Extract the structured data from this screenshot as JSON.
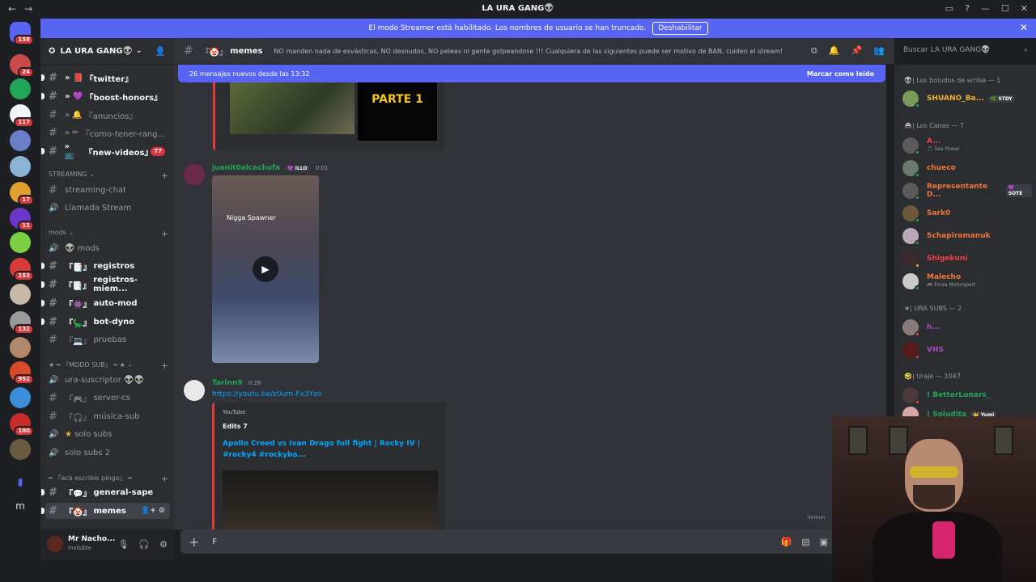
{
  "titlebar": {
    "title": "LA URA GANG👽",
    "back": "←",
    "forward": "→",
    "right_icons": [
      "▭",
      "?",
      "—",
      "☐",
      "✕"
    ]
  },
  "banner": {
    "text": "El modo Streamer está habilitado. Los nombres de usuario se han truncado.",
    "button": "Deshabilitar",
    "close": "✕"
  },
  "guilds": [
    {
      "name": "discord-home-icon",
      "badge": "158",
      "color": "#5865f2"
    },
    {
      "name": "server-icon-1",
      "badge": "24",
      "color": "#c94b4b"
    },
    {
      "name": "server-icon-2",
      "badge": "",
      "color": "#23a559"
    },
    {
      "name": "server-icon-3",
      "badge": "117",
      "color": "#f2f3f5"
    },
    {
      "name": "server-icon-4",
      "badge": "",
      "color": "#6a7ec9"
    },
    {
      "name": "server-icon-5",
      "badge": "",
      "color": "#8ab4d6"
    },
    {
      "name": "server-icon-6",
      "badge": "17",
      "color": "#e0a030"
    },
    {
      "name": "server-icon-7",
      "badge": "11",
      "color": "#6b35c9"
    },
    {
      "name": "server-icon-8",
      "badge": "",
      "color": "#7ccf44"
    },
    {
      "name": "server-icon-9",
      "badge": "153",
      "color": "#d83a3a"
    },
    {
      "name": "server-icon-10",
      "badge": "",
      "color": "#c7b8a8"
    },
    {
      "name": "server-icon-11",
      "badge": "132",
      "color": "#9a9a9a"
    },
    {
      "name": "server-icon-12",
      "badge": "",
      "color": "#b2876a"
    },
    {
      "name": "server-icon-13",
      "badge": "952",
      "color": "#d84a2a"
    },
    {
      "name": "server-icon-14",
      "badge": "",
      "color": "#3b8ed8"
    },
    {
      "name": "server-icon-15",
      "badge": "100",
      "color": "#c92a2a"
    },
    {
      "name": "server-icon-16",
      "badge": "",
      "color": "#6a5a40"
    }
  ],
  "server": {
    "name": "LA URA GANG👽",
    "channels": [
      {
        "label": "『twitter』",
        "prefix": "» 📕",
        "bold": true,
        "badge": ""
      },
      {
        "label": "『boost-honors』",
        "prefix": "» 💜",
        "bold": true,
        "badge": ""
      },
      {
        "label": "『anuncios』",
        "prefix": "» 🔔",
        "bold": false,
        "badge": ""
      },
      {
        "label": "『como-tener-rang...",
        "prefix": "» ✏",
        "bold": false,
        "badge": ""
      },
      {
        "label": "『new-videos』",
        "prefix": "» 📺",
        "bold": true,
        "badge": "77"
      }
    ],
    "cat_streaming": "STREAMING",
    "streaming": [
      {
        "label": "streaming-chat",
        "icon": "#"
      },
      {
        "label": "Llamada Stream",
        "icon": "🔊"
      }
    ],
    "cat_mods": "mods",
    "mods": [
      {
        "label": "mods",
        "icon": "🔊",
        "prefix": "👽",
        "bold": false
      },
      {
        "label": "registros",
        "icon": "#",
        "prefix": "『📑』",
        "bold": true
      },
      {
        "label": "registros-miem...",
        "icon": "#",
        "prefix": "『📑』",
        "bold": true
      },
      {
        "label": "auto-mod",
        "icon": "#",
        "prefix": "『👾』",
        "bold": true
      },
      {
        "label": "bot-dyno",
        "icon": "#",
        "prefix": "『🦕』",
        "bold": true
      },
      {
        "label": "pruebas",
        "icon": "#",
        "prefix": "『💻』",
        "bold": false
      }
    ],
    "cat_modo_sub": "★ ━ 『MODO SUB』 ━ ★",
    "modo_sub": [
      {
        "label": "ura-suscriptor 👽👽",
        "icon": "🔊",
        "prefix": "",
        "bold": false
      },
      {
        "label": "server-cs",
        "icon": "#",
        "prefix": "『🎮』",
        "bold": false
      },
      {
        "label": "música-sub",
        "icon": "#",
        "prefix": "『🎧』",
        "bold": false
      },
      {
        "label": "solo subs",
        "icon": "🔊",
        "prefix": "★",
        "bold": false
      },
      {
        "label": "solo subs 2",
        "icon": "🔊",
        "prefix": "",
        "bold": false
      }
    ],
    "cat_aca": "━ 『acá escribís pingo』 ━",
    "aca": [
      {
        "label": "general-sape",
        "prefix": "『💬』",
        "active": false
      },
      {
        "label": "memes",
        "prefix": "『🤡』",
        "active": true
      }
    ]
  },
  "user": {
    "name": "Mr Nacho...",
    "status": "Invisible"
  },
  "chat_header": {
    "channel": "memes",
    "prefix": "『🤡』",
    "topic": "NO manden nada de esvásticas, NO desnudos, NO peleas ni gente golpeandose !!! Cualquiera de las siguientes puede ser motivo de BAN, cuiden el stream!",
    "search_placeholder": "Buscar LA URA GANG👽"
  },
  "new_messages": {
    "text": "26 mensajes nuevos desde las 13:32",
    "action": "Marcar como leído"
  },
  "top_embed": {
    "label": "PARTE 1"
  },
  "messages": [
    {
      "author": "juanit0alcachofa",
      "tag": "💜 ILLO",
      "time": "0:01",
      "color": "#23a559",
      "video_text": "Nigga Spawner"
    },
    {
      "author": "Tarinn9",
      "time": "0:26",
      "color": "#23a559",
      "link": "https://youtu.be/z0um-Fx3Yzo",
      "embed": {
        "provider": "YouTube",
        "author": "Edits 7",
        "title": "Apollo Creed vs Ivan Drago full fight | Rocky IV | #rocky4 #rockyba..."
      }
    }
  ],
  "composer": {
    "typed": "F",
    "overlay_text": "Immun"
  },
  "members": {
    "categories": [
      {
        "label": "👽| Los boludos de arriba — 1"
      },
      {
        "label": "🚔| Los Canas — 7"
      },
      {
        "label": "★| URA SUBS — 2"
      },
      {
        "label": "🤣| Uraje — 1047"
      }
    ],
    "list": [
      {
        "name": "SHUANO_Ba...",
        "sub": "",
        "tag": "🌿 STDY",
        "color": "#f0b232",
        "status": "#23a559",
        "av": "#7a9a5a"
      },
      {
        "name": "A...",
        "sub": "🎵 Sea Power",
        "tag": "",
        "color": "#f23f43",
        "status": "#23a559",
        "av": "#5a5a5a"
      },
      {
        "name": "chueco",
        "sub": "",
        "tag": "",
        "color": "#f0773c",
        "status": "#23a559",
        "av": "#6a7a6a"
      },
      {
        "name": "Representante D...",
        "sub": "",
        "tag": "💜 SOTE",
        "color": "#f0773c",
        "status": "#23a559",
        "av": "#5a5a5a"
      },
      {
        "name": "Sark0",
        "sub": "",
        "tag": "",
        "color": "#f0773c",
        "status": "#23a559",
        "av": "#6a5a3a"
      },
      {
        "name": "Schapiramanuk",
        "sub": "",
        "tag": "",
        "color": "#f0773c",
        "status": "#23a559",
        "av": "#b8a8b8"
      },
      {
        "name": "Shigekuni",
        "sub": "",
        "tag": "",
        "color": "#f23f43",
        "status": "#f0b232",
        "av": "#3a2a2a"
      },
      {
        "name": "Malecho",
        "sub": "🎮 Forza Motorsport",
        "tag": "",
        "color": "#f0773c",
        "status": "#23a559",
        "av": "#cacaca"
      },
      {
        "name": "h...",
        "sub": "",
        "tag": "",
        "color": "#a94ac9",
        "status": "#f23f43",
        "av": "#8a7a7a"
      },
      {
        "name": "VHS",
        "sub": "",
        "tag": "",
        "color": "#a94ac9",
        "status": "#f23f43",
        "av": "#5a1a1a"
      },
      {
        "name": "! BetterLunars_",
        "sub": "",
        "tag": "",
        "color": "#23a559",
        "status": "#f23f43",
        "av": "#4a3a3a"
      },
      {
        "name": "! Soludita",
        "sub": "",
        "tag": "👑 Yumi",
        "color": "#23a559",
        "status": "#23a559",
        "av": "#d8a8a8"
      }
    ]
  }
}
